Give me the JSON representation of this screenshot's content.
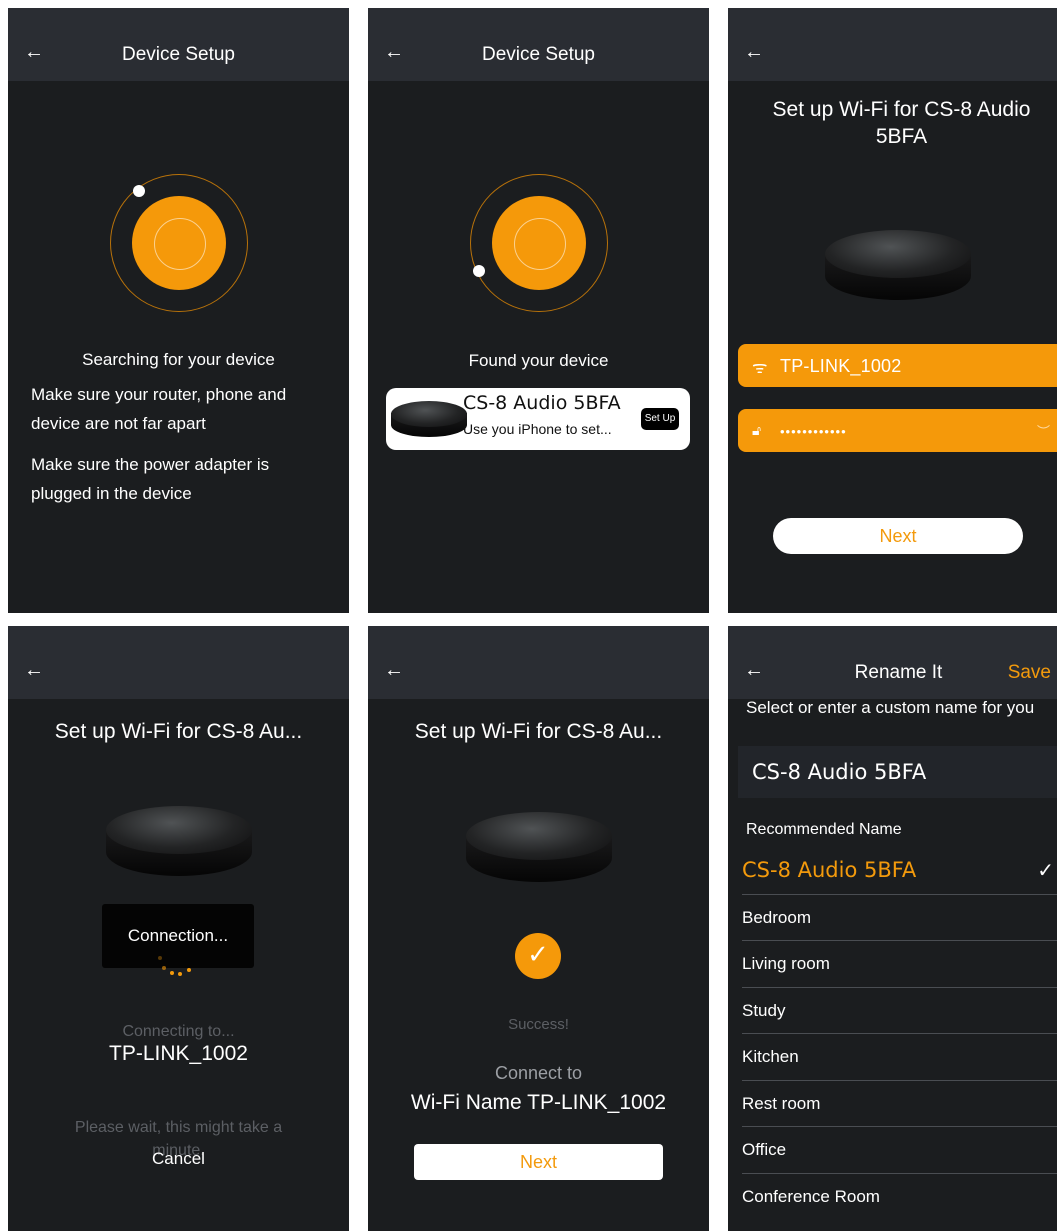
{
  "screens": {
    "searching": {
      "title": "Device Setup",
      "back": "←",
      "status": "Searching for your device",
      "tip1": "Make sure your router, phone and device are not far apart",
      "tip2": "Make sure the power adapter is plugged in the device"
    },
    "found": {
      "title": "Device Setup",
      "back": "←",
      "status": "Found your device",
      "device_name": "CS-8 Audio 5BFA",
      "device_sub": "Use you iPhone to set...",
      "setup_label": "Set Up"
    },
    "wifi": {
      "back": "←",
      "heading": "Set up Wi-Fi for CS-8 Audio 5BFA",
      "ssid": "TP-LINK_1002",
      "password_mask": "••••••••••••",
      "next_label": "Next",
      "icons": {
        "wifi": "wifi-icon",
        "lock": "lock-icon",
        "eye": "eye-closed-icon"
      }
    },
    "connecting": {
      "back": "←",
      "heading": "Set up Wi-Fi for CS-8 Au...",
      "toast": "Connection...",
      "connecting_to": "Connecting to...",
      "ssid": "TP-LINK_1002",
      "wait_text": "Please wait, this might take a minute.",
      "cancel_label": "Cancel"
    },
    "success": {
      "back": "←",
      "heading": "Set up Wi-Fi for CS-8 Au...",
      "status": "Success!",
      "connect_to": "Connect to",
      "wifi_name": "Wi-Fi Name TP-LINK_1002",
      "next_label": "Next"
    },
    "rename": {
      "back": "←",
      "title": "Rename It",
      "save_label": "Save",
      "prompt": "Select or enter a custom name for you",
      "current_name": "CS-8 Audio 5BFA",
      "recommended_label": "Recommended Name",
      "options": [
        "CS-8 Audio 5BFA",
        "Bedroom",
        "Living room",
        "Study",
        "Kitchen",
        "Rest room",
        "Office",
        "Conference Room"
      ],
      "selected_index": 0,
      "check_glyph": "✓"
    }
  },
  "colors": {
    "accent": "#f5990a",
    "background": "#1b1d1f",
    "topbar": "#2a2d33"
  }
}
